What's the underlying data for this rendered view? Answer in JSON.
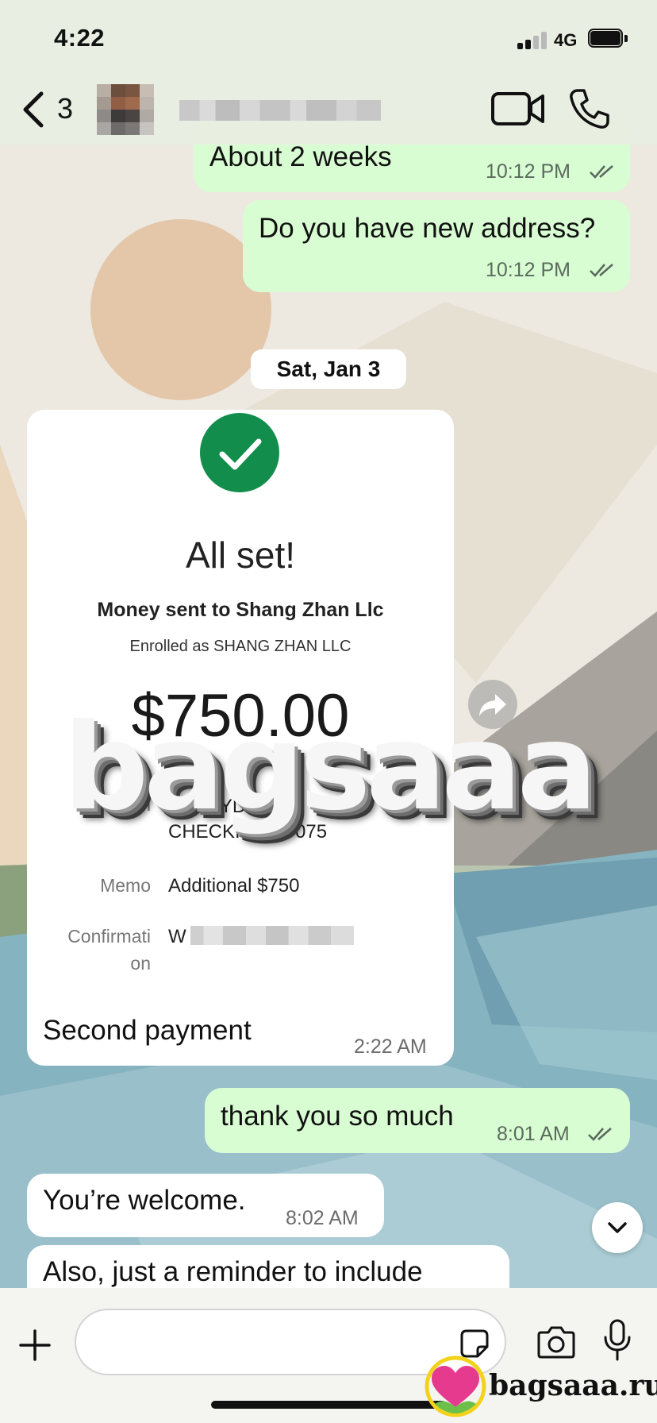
{
  "status_bar": {
    "time": "4:22",
    "network": "4G"
  },
  "header": {
    "unread_count": "3",
    "contact_name_redacted": true
  },
  "messages": [
    {
      "text": "About 2 weeks",
      "time": "10:12 PM",
      "direction": "outgoing",
      "read": true
    },
    {
      "text": "Do you have new address?",
      "time": "10:12 PM",
      "direction": "outgoing",
      "read": true
    },
    {
      "text": "thank you so much",
      "time": "8:01 AM",
      "direction": "outgoing",
      "read": true
    },
    {
      "text": "You’re welcome.",
      "time": "8:02 AM",
      "direction": "incoming"
    },
    {
      "text": "Also, just a reminder to include",
      "direction": "incoming"
    }
  ],
  "date_separator": "Sat, Jan 3",
  "payment_card": {
    "title": "All set!",
    "subtitle": "Money sent to Shang Zhan Llc",
    "enrolled": "Enrolled as SHANG ZHAN LLC",
    "amount": "$750.00",
    "from_label": "From",
    "from_value_line1": "EVERYDAY",
    "from_value_line2": "CHECKING...9075",
    "memo_label": "Memo",
    "memo_value": "Additional $750",
    "confirmation_label_line1": "Confirmati",
    "confirmation_label_line2": "on",
    "confirmation_value_visible": "W",
    "caption": "Second payment",
    "time": "2:22 AM",
    "check_color": "#128d4b"
  },
  "composer": {
    "placeholder": ""
  },
  "watermark": {
    "text": "bagsaaa",
    "site": "bagsaaa.ru"
  },
  "colors": {
    "outgoing_bubble": "#d9fdd3",
    "incoming_bubble": "#ffffff",
    "accent_green": "#128d4b"
  }
}
